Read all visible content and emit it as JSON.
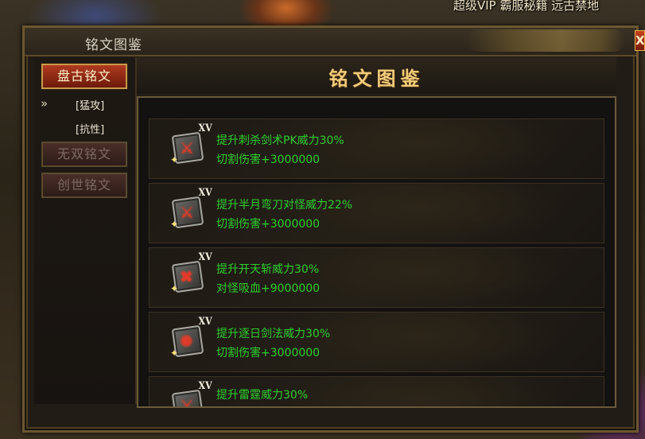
{
  "top_banner": "超级VIP  霸服秘籍  远古禁地",
  "window": {
    "title": "铭文图鉴",
    "close_label": "X"
  },
  "sidebar": {
    "categories": [
      {
        "label": "盘古铭文",
        "state": "active"
      },
      {
        "label": "无双铭文",
        "state": "inactive"
      },
      {
        "label": "创世铭文",
        "state": "inactive"
      }
    ],
    "sub_items": [
      "[猛攻]",
      "[抗性]"
    ],
    "sub_arrow": "»"
  },
  "content": {
    "title": "铭文图鉴",
    "entries": [
      {
        "level": "XV",
        "icon": "sword-slash-icon",
        "desc": "提升刺杀剑术PK威力30%",
        "effect": "切割伤害+3000000"
      },
      {
        "level": "XV",
        "icon": "crescent-blade-icon",
        "desc": "提升半月弯刀对怪威力22%",
        "effect": "切割伤害+3000000"
      },
      {
        "level": "XV",
        "icon": "cleave-icon",
        "desc": "提升开天斩威力30%",
        "effect": "对怪吸血+9000000"
      },
      {
        "level": "XV",
        "icon": "sun-sword-icon",
        "desc": "提升逐日剑法威力30%",
        "effect": "切割伤害+3000000"
      },
      {
        "level": "XV",
        "icon": "partial-icon",
        "desc": "提升雷霆威力30%",
        "effect": ""
      }
    ]
  },
  "colors": {
    "effect_text": "#2ecf2e",
    "title_gold": "#f0cc7c",
    "active_button": "#b03a20"
  }
}
